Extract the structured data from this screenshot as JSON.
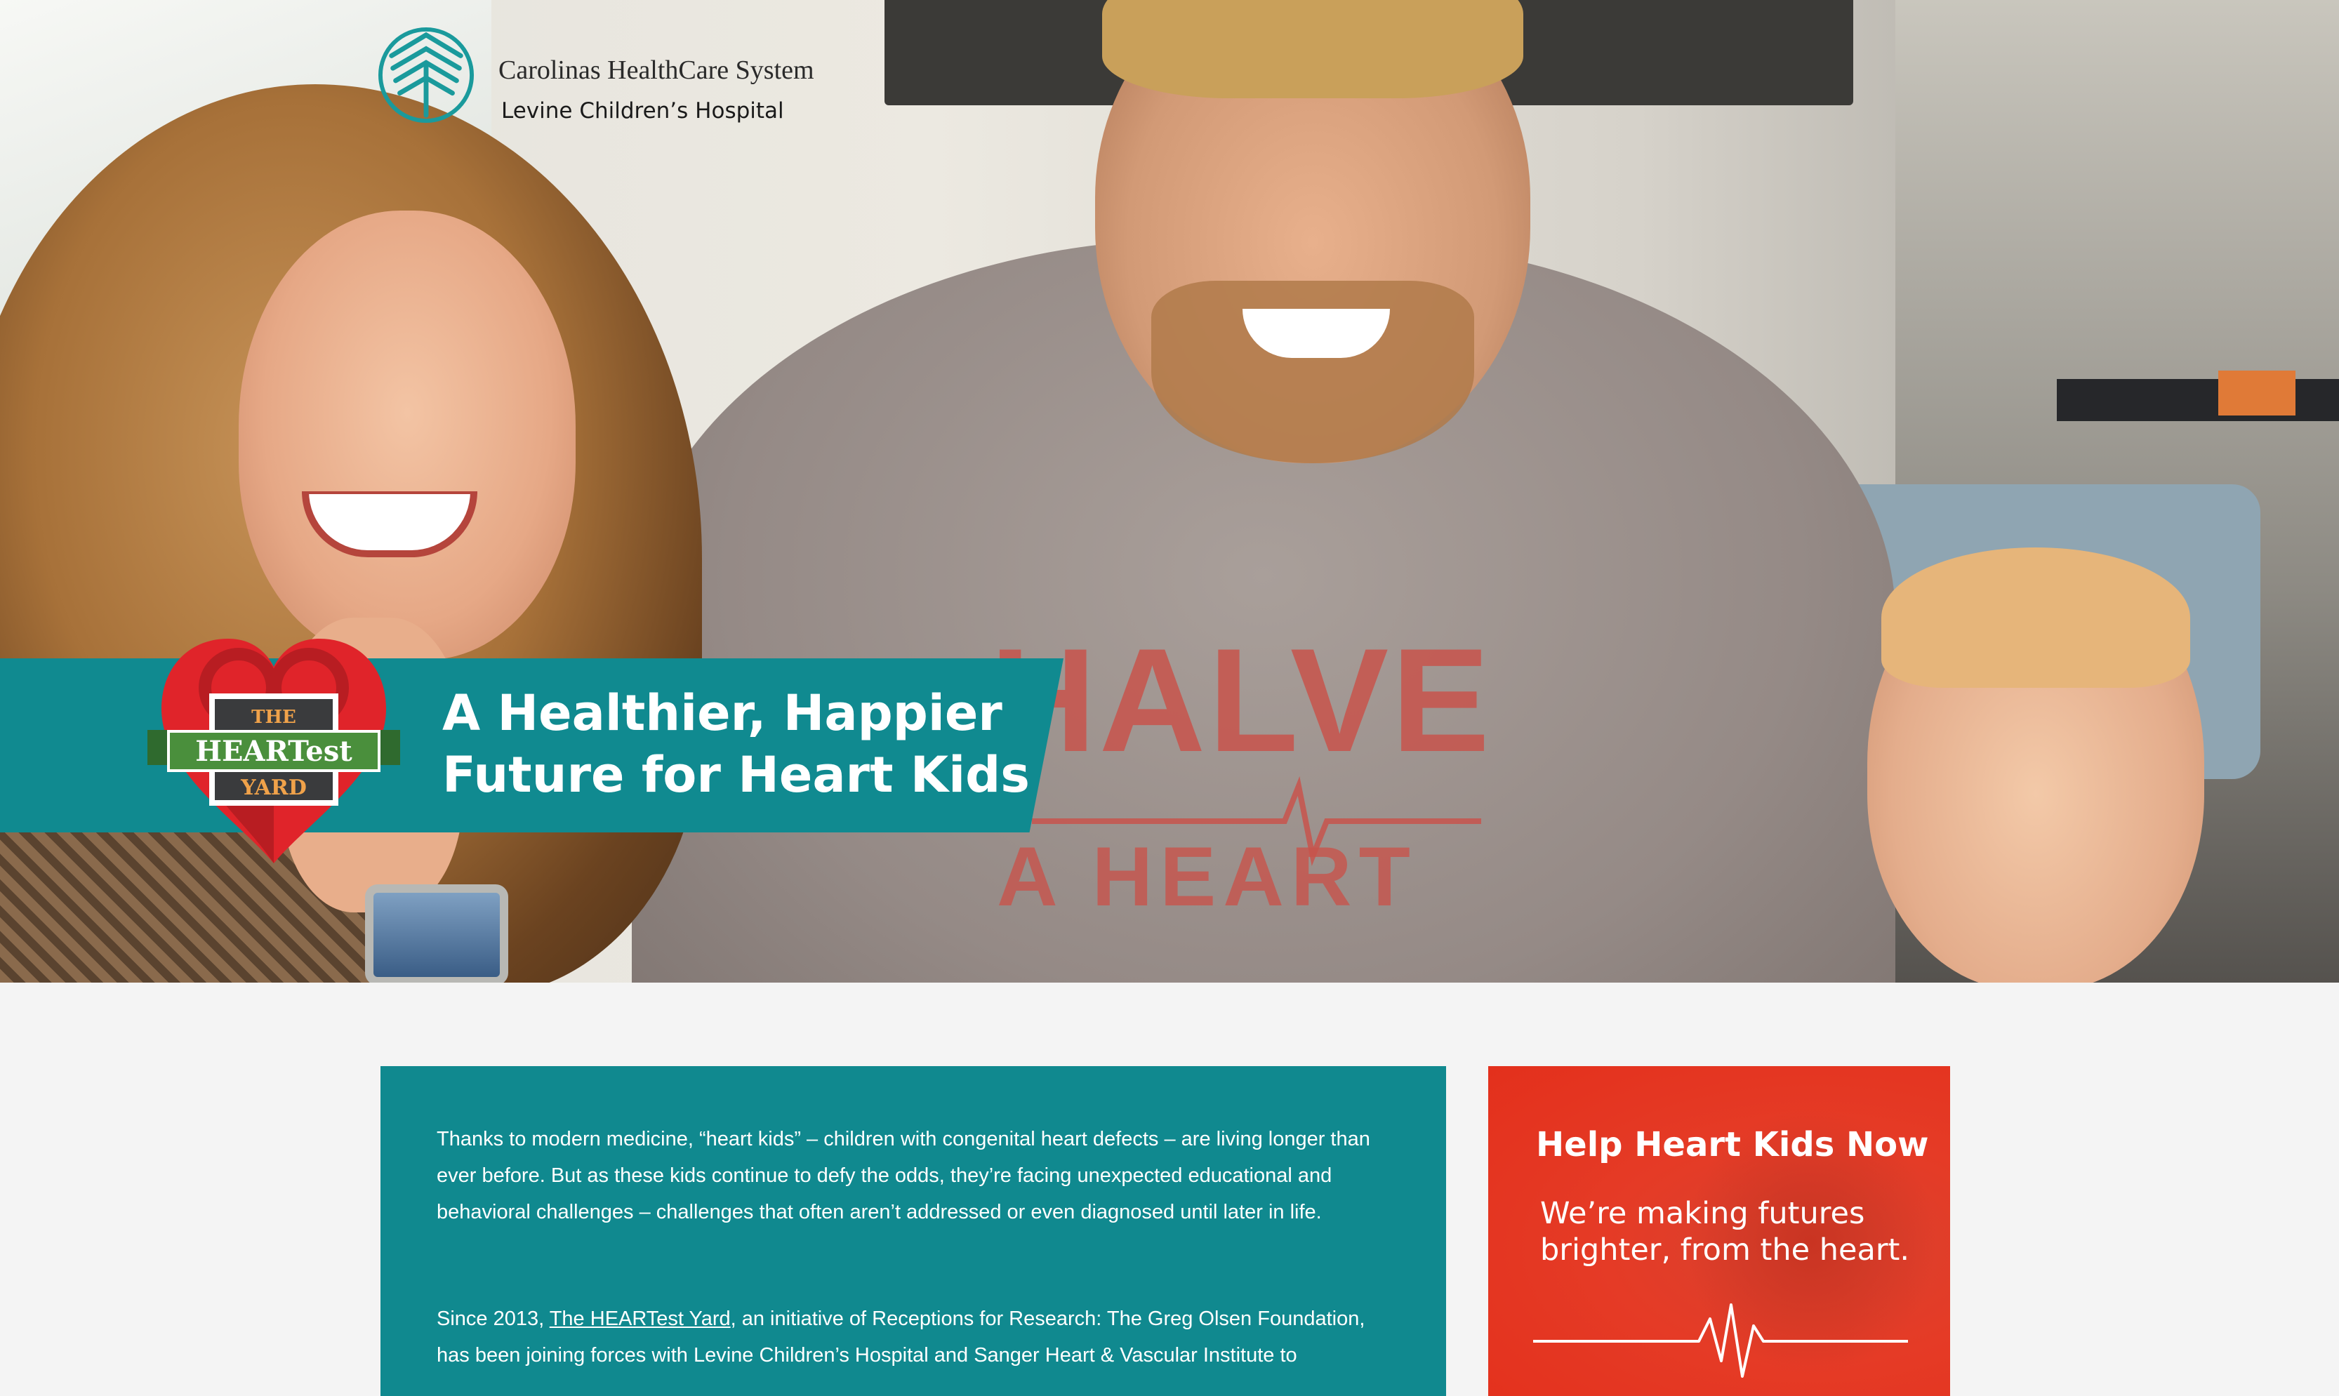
{
  "header": {
    "logo_system": "Carolinas HealthCare System",
    "logo_hospital": "Levine Children’s Hospital"
  },
  "hero": {
    "badge": {
      "line_top": "THE",
      "line_mid": "HEARTest",
      "line_bottom": "YARD"
    },
    "headline": "A Healthier, Happier Future for Heart Kids",
    "shirt_print_top": "HALVE",
    "shirt_print_bottom": "A HEART"
  },
  "main": {
    "intro": "Thanks to modern medicine, “heart kids” – children with congenital heart defects – are living longer than ever before. But as these kids continue to defy the odds, they’re facing unexpected educational and behavioral challenges – challenges that often aren’t addressed or even diagnosed until later in life.",
    "second_prefix": "Since 2013, ",
    "second_link": "The HEARTest Yard",
    "second_suffix": ", an initiative of Receptions for Research: The Greg Olsen Foundation, has been joining forces with Levine Children’s Hospital and Sanger Heart & Vascular Institute to"
  },
  "cta": {
    "title": "Help Heart Kids Now",
    "subtitle": "We’re making futures brighter, from the heart."
  },
  "colors": {
    "teal": "#108a90",
    "red": "#e3301c",
    "background": "#f4f4f4"
  }
}
